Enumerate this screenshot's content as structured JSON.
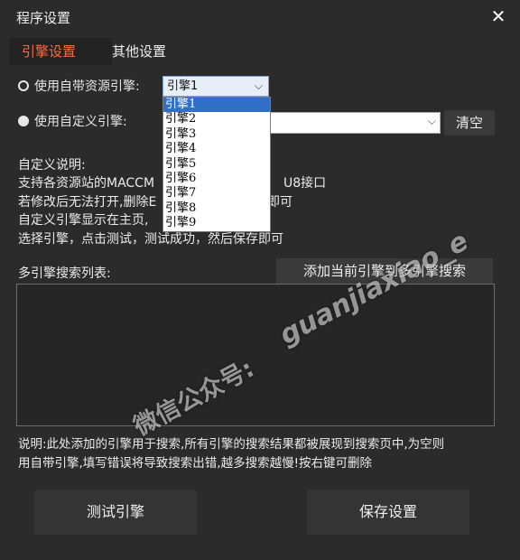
{
  "window": {
    "title": "程序设置",
    "close_glyph": "✕"
  },
  "tabs": [
    {
      "label": "引擎设置",
      "active": true
    },
    {
      "label": "其他设置",
      "active": false
    }
  ],
  "engine": {
    "builtin_label": "使用自带资源引擎:",
    "builtin_selected": "引擎1",
    "custom_label": "使用自定义引擎:",
    "clear_label": "清空",
    "dropdown_options": [
      "引擎1",
      "引擎2",
      "引擎3",
      "引擎4",
      "引擎5",
      "引擎6",
      "引擎7",
      "引擎8",
      "引擎9"
    ]
  },
  "explain": {
    "title": "自定义说明:",
    "line1": "支持各资源站的MACCM",
    "line1b": "U8接口",
    "line2": "若修改后无法打开,删除E",
    "line2b": "即可",
    "line3": "自定义引擎显示在主页,",
    "line4": "选择引擎，点击测试，测试成功，然后保存即可"
  },
  "multi": {
    "label": "多引擎搜索列表:",
    "add_label": "添加当前引擎到多引擎搜索"
  },
  "note": {
    "line1": "说明:此处添加的引擎用于搜索,所有引擎的搜索结果都被展现到搜索页中,为空则",
    "line2": "用自带引擎,填写错误将导致搜索出错,越多搜索越慢!按右键可删除"
  },
  "buttons": {
    "test": "测试引擎",
    "save": "保存设置"
  },
  "watermark": {
    "handle": "guanjiaxiao_e",
    "cn": "微信公众号:"
  },
  "icons": {
    "dropdown_arrow": "chevron-down-icon",
    "close": "close-icon"
  },
  "colors": {
    "accent": "#ff6a3d",
    "background": "#2b2b2b",
    "selection": "#2f6fc8"
  }
}
